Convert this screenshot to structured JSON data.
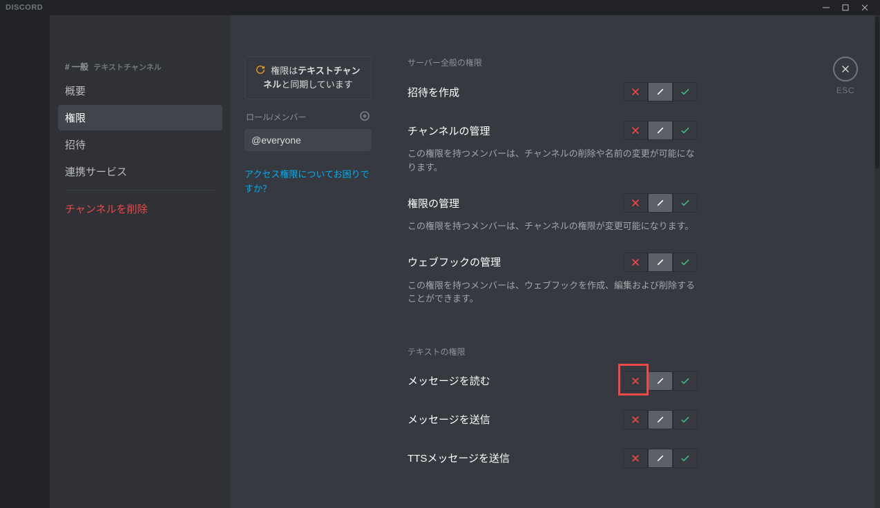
{
  "brand": "DISCORD",
  "sidebar": {
    "channelPrefix": "# 一般",
    "channelType": "テキストチャンネル",
    "items": [
      "概要",
      "権限",
      "招待",
      "連携サービス"
    ],
    "delete": "チャンネルを削除"
  },
  "roles": {
    "syncText1": "権限は",
    "syncBold1": "テキストチャンネル",
    "syncText2": "と同期しています",
    "label": "ロール/メンバー",
    "selected": "@everyone",
    "helpLink": "アクセス権限についてお困りですか？"
  },
  "close": {
    "label": "ESC"
  },
  "sections": {
    "server": "サーバー全般の権限",
    "text": "テキストの権限"
  },
  "perms": {
    "invite": {
      "title": "招待を作成"
    },
    "manageChannel": {
      "title": "チャンネルの管理",
      "desc": "この権限を持つメンバーは、チャンネルの削除や名前の変更が可能になります。"
    },
    "managePerms": {
      "title": "権限の管理",
      "desc": "この権限を持つメンバーは、チャンネルの権限が変更可能になります。"
    },
    "manageWebhooks": {
      "title": "ウェブフックの管理",
      "desc": "この権限を持つメンバーは、ウェブフックを作成、編集および削除することができます。"
    },
    "readMessages": {
      "title": "メッセージを読む"
    },
    "sendMessages": {
      "title": "メッセージを送信"
    },
    "sendTTS": {
      "title": "TTSメッセージを送信"
    }
  }
}
